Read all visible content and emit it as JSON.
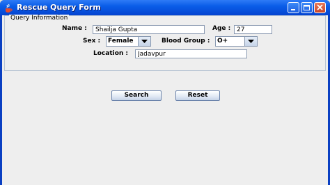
{
  "window": {
    "title": "Rescue Query Form"
  },
  "group": {
    "title": "Query Information"
  },
  "form": {
    "name": {
      "label": "Name :",
      "value": "Shailja Gupta"
    },
    "age": {
      "label": "Age :",
      "value": "27"
    },
    "sex": {
      "label": "Sex :",
      "value": "Female"
    },
    "blood_group": {
      "label": "Blood Group :",
      "value": "O+"
    },
    "location": {
      "label": "Location :",
      "value": "Jadavpur"
    }
  },
  "buttons": {
    "search": "Search",
    "reset": "Reset"
  },
  "icons": {
    "app": "java-cup-icon",
    "minimize": "minimize-icon",
    "maximize": "maximize-icon",
    "close": "close-icon",
    "dropdown": "chevron-down-icon"
  }
}
